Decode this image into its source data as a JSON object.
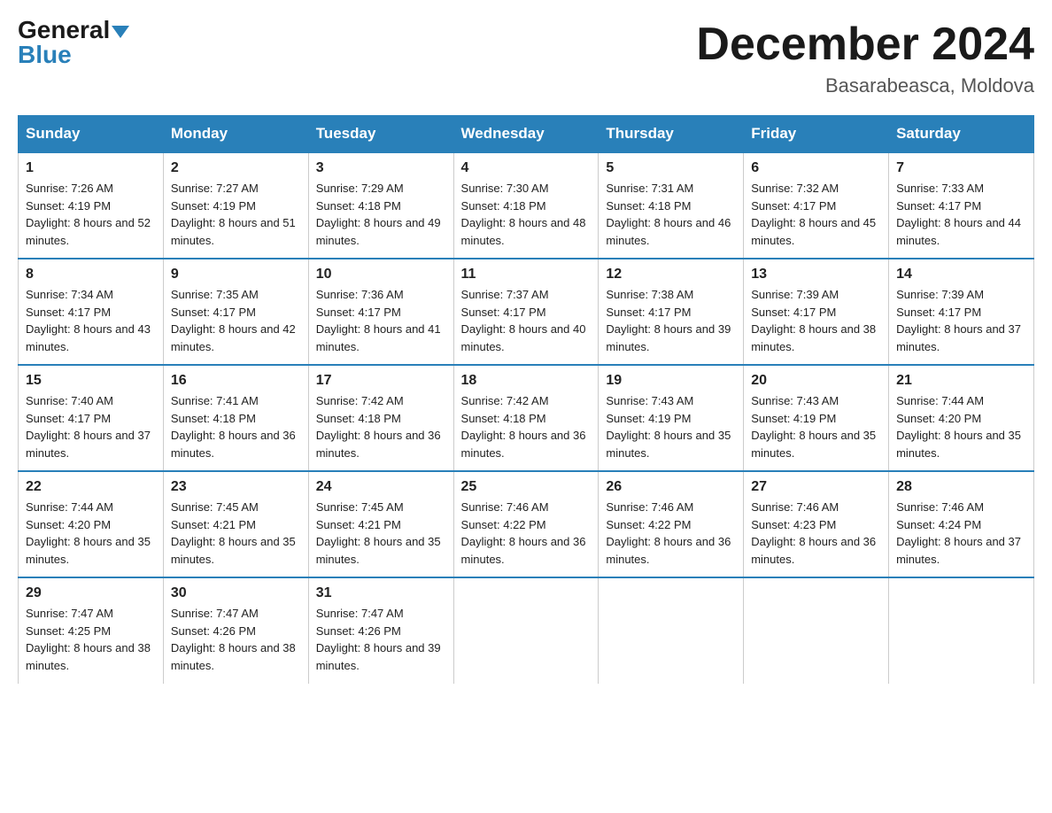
{
  "logo": {
    "general": "General",
    "blue": "Blue"
  },
  "title": "December 2024",
  "subtitle": "Basarabeasca, Moldova",
  "days_header": [
    "Sunday",
    "Monday",
    "Tuesday",
    "Wednesday",
    "Thursday",
    "Friday",
    "Saturday"
  ],
  "weeks": [
    [
      {
        "day": "1",
        "sunrise": "7:26 AM",
        "sunset": "4:19 PM",
        "daylight": "8 hours and 52 minutes."
      },
      {
        "day": "2",
        "sunrise": "7:27 AM",
        "sunset": "4:19 PM",
        "daylight": "8 hours and 51 minutes."
      },
      {
        "day": "3",
        "sunrise": "7:29 AM",
        "sunset": "4:18 PM",
        "daylight": "8 hours and 49 minutes."
      },
      {
        "day": "4",
        "sunrise": "7:30 AM",
        "sunset": "4:18 PM",
        "daylight": "8 hours and 48 minutes."
      },
      {
        "day": "5",
        "sunrise": "7:31 AM",
        "sunset": "4:18 PM",
        "daylight": "8 hours and 46 minutes."
      },
      {
        "day": "6",
        "sunrise": "7:32 AM",
        "sunset": "4:17 PM",
        "daylight": "8 hours and 45 minutes."
      },
      {
        "day": "7",
        "sunrise": "7:33 AM",
        "sunset": "4:17 PM",
        "daylight": "8 hours and 44 minutes."
      }
    ],
    [
      {
        "day": "8",
        "sunrise": "7:34 AM",
        "sunset": "4:17 PM",
        "daylight": "8 hours and 43 minutes."
      },
      {
        "day": "9",
        "sunrise": "7:35 AM",
        "sunset": "4:17 PM",
        "daylight": "8 hours and 42 minutes."
      },
      {
        "day": "10",
        "sunrise": "7:36 AM",
        "sunset": "4:17 PM",
        "daylight": "8 hours and 41 minutes."
      },
      {
        "day": "11",
        "sunrise": "7:37 AM",
        "sunset": "4:17 PM",
        "daylight": "8 hours and 40 minutes."
      },
      {
        "day": "12",
        "sunrise": "7:38 AM",
        "sunset": "4:17 PM",
        "daylight": "8 hours and 39 minutes."
      },
      {
        "day": "13",
        "sunrise": "7:39 AM",
        "sunset": "4:17 PM",
        "daylight": "8 hours and 38 minutes."
      },
      {
        "day": "14",
        "sunrise": "7:39 AM",
        "sunset": "4:17 PM",
        "daylight": "8 hours and 37 minutes."
      }
    ],
    [
      {
        "day": "15",
        "sunrise": "7:40 AM",
        "sunset": "4:17 PM",
        "daylight": "8 hours and 37 minutes."
      },
      {
        "day": "16",
        "sunrise": "7:41 AM",
        "sunset": "4:18 PM",
        "daylight": "8 hours and 36 minutes."
      },
      {
        "day": "17",
        "sunrise": "7:42 AM",
        "sunset": "4:18 PM",
        "daylight": "8 hours and 36 minutes."
      },
      {
        "day": "18",
        "sunrise": "7:42 AM",
        "sunset": "4:18 PM",
        "daylight": "8 hours and 36 minutes."
      },
      {
        "day": "19",
        "sunrise": "7:43 AM",
        "sunset": "4:19 PM",
        "daylight": "8 hours and 35 minutes."
      },
      {
        "day": "20",
        "sunrise": "7:43 AM",
        "sunset": "4:19 PM",
        "daylight": "8 hours and 35 minutes."
      },
      {
        "day": "21",
        "sunrise": "7:44 AM",
        "sunset": "4:20 PM",
        "daylight": "8 hours and 35 minutes."
      }
    ],
    [
      {
        "day": "22",
        "sunrise": "7:44 AM",
        "sunset": "4:20 PM",
        "daylight": "8 hours and 35 minutes."
      },
      {
        "day": "23",
        "sunrise": "7:45 AM",
        "sunset": "4:21 PM",
        "daylight": "8 hours and 35 minutes."
      },
      {
        "day": "24",
        "sunrise": "7:45 AM",
        "sunset": "4:21 PM",
        "daylight": "8 hours and 35 minutes."
      },
      {
        "day": "25",
        "sunrise": "7:46 AM",
        "sunset": "4:22 PM",
        "daylight": "8 hours and 36 minutes."
      },
      {
        "day": "26",
        "sunrise": "7:46 AM",
        "sunset": "4:22 PM",
        "daylight": "8 hours and 36 minutes."
      },
      {
        "day": "27",
        "sunrise": "7:46 AM",
        "sunset": "4:23 PM",
        "daylight": "8 hours and 36 minutes."
      },
      {
        "day": "28",
        "sunrise": "7:46 AM",
        "sunset": "4:24 PM",
        "daylight": "8 hours and 37 minutes."
      }
    ],
    [
      {
        "day": "29",
        "sunrise": "7:47 AM",
        "sunset": "4:25 PM",
        "daylight": "8 hours and 38 minutes."
      },
      {
        "day": "30",
        "sunrise": "7:47 AM",
        "sunset": "4:26 PM",
        "daylight": "8 hours and 38 minutes."
      },
      {
        "day": "31",
        "sunrise": "7:47 AM",
        "sunset": "4:26 PM",
        "daylight": "8 hours and 39 minutes."
      },
      null,
      null,
      null,
      null
    ]
  ]
}
